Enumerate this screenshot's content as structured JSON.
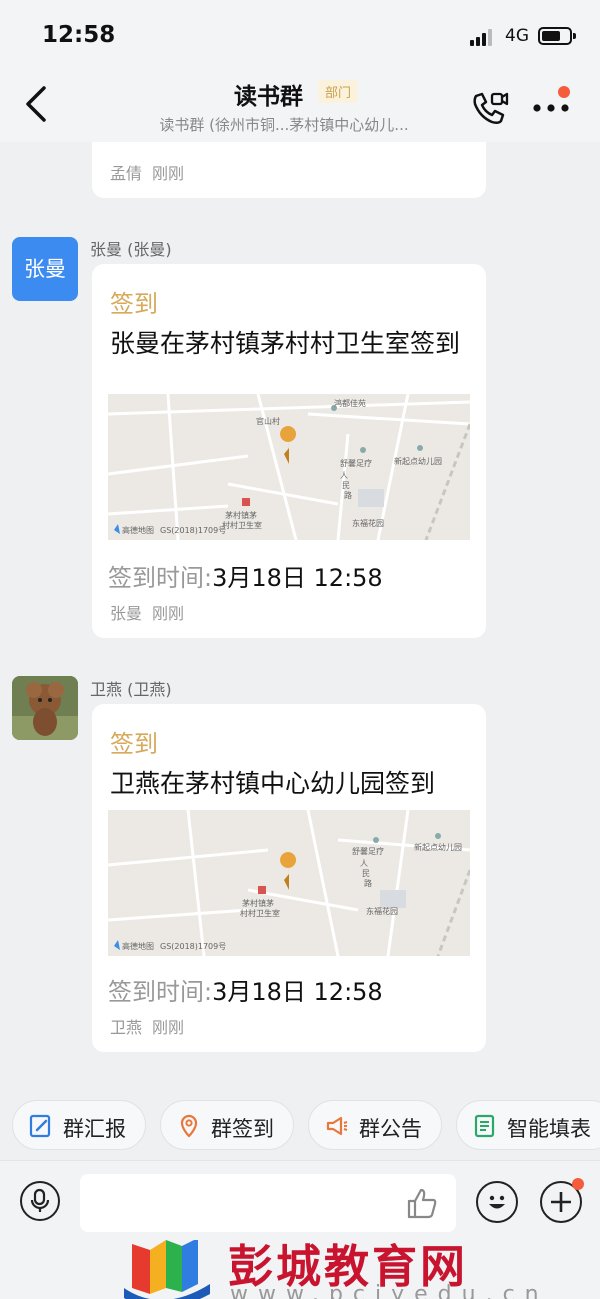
{
  "status_bar": {
    "time": "12:58",
    "network": "4G"
  },
  "header": {
    "title": "读书群",
    "badge": "部门",
    "subtitle": "读书群 (徐州市铜...茅村镇中心幼儿...",
    "icons": [
      "back-icon",
      "video-call-icon",
      "more-icon"
    ]
  },
  "messages": [
    {
      "type": "checkin-partial",
      "author": "孟倩",
      "time": "刚刚"
    },
    {
      "type": "checkin",
      "sender": "张曼 (张曼)",
      "avatar_text": "张曼",
      "label": "签到",
      "text": "张曼在茅村镇茅村村卫生室签到",
      "map_labels": [
        "鸿都佳苑",
        "官山村",
        "舒馨足疗",
        "新起点幼儿园",
        "人民路",
        "茅村镇茅",
        "村村卫生室",
        "东福花园",
        "高德地图",
        "GS(2018)1709号"
      ],
      "time_label": "签到时间:",
      "time_value": "3月18日 12:58",
      "author": "张曼",
      "time": "刚刚"
    },
    {
      "type": "checkin",
      "sender": "卫燕 (卫燕)",
      "label": "签到",
      "text": "卫燕在茅村镇中心幼儿园签到",
      "map_labels": [
        "舒馨足疗",
        "新起点幼儿园",
        "人民路",
        "茅村镇茅",
        "村村卫生室",
        "东福花园",
        "高德地图",
        "GS(2018)1709号"
      ],
      "time_label": "签到时间:",
      "time_value": "3月18日 12:58",
      "author": "卫燕",
      "time": "刚刚"
    }
  ],
  "quick_actions": [
    "群汇报",
    "群签到",
    "群公告",
    "智能填表"
  ],
  "input": {
    "placeholder": ""
  },
  "watermark": {
    "name": "彭城教育网",
    "url": "www.pcjyedu.cn"
  },
  "colors": {
    "accent_gold": "#d7a95a",
    "avatar_blue": "#3c8bf0",
    "notify_red": "#f45c3c",
    "watermark_red": "#c8142f"
  }
}
